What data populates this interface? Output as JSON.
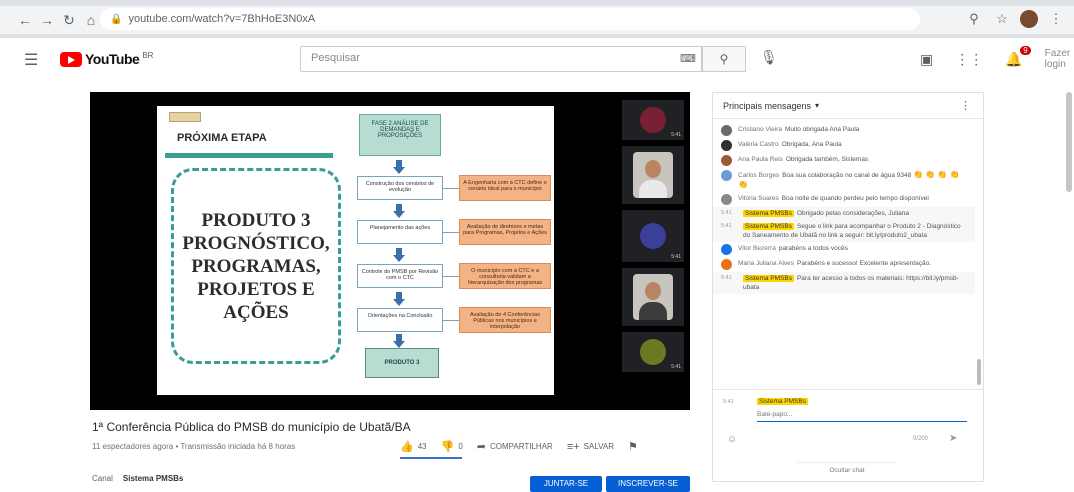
{
  "browser": {
    "url": "youtube.com/watch?v=7BhHoE3N0xA",
    "back_glyph": "←",
    "forward_glyph": "→",
    "reload_glyph": "↻",
    "home_glyph": "⌂"
  },
  "header": {
    "logo_text": "YouTube",
    "country_code": "BR",
    "search_placeholder": "Pesquisar",
    "signin_label": "Fazer login"
  },
  "slide": {
    "next_step": "PRÓXIMA ETAPA",
    "product_lines": [
      "PRODUTO 3",
      "PROGNÓSTICO,",
      "PROGRAMAS,",
      "PROJETOS E",
      "AÇÕES"
    ],
    "top_box": "FASE 2 ANÁLISE DE DEMANDAS E PROPOSIÇÕES",
    "steps": [
      "Construção dos cenários de evolução",
      "Planejamento das ações",
      "Controle do PMSB por Revisão com o CTC",
      "Orientações na Conclusão"
    ],
    "notes": [
      "A Engenharia com a CTC define o cenário ideal para o município",
      "Avaliação de diretrizes e metas para Programas, Projetos e Ações",
      "O município com a CTC e a consultoria validam a hierarquização dos programas",
      "Avaliação de 4 Conferências Públicas nos municípios e interpolação"
    ],
    "final_doc": "PRODUTO 3"
  },
  "participants": [
    {
      "time": "5:41",
      "color": "#7a2033"
    },
    {
      "time": "5:41",
      "color": "#3a3f9a"
    },
    {
      "time": "5:41",
      "color": "#6b7a20"
    }
  ],
  "video": {
    "title": "1ª Conferência Pública do PMSB do município de Ubatã/BA",
    "meta": "11 espectadores agora • Transmissão iniciada há 8 horas",
    "like_count": "43",
    "dislike_count": "0",
    "share_label": "COMPARTILHAR",
    "save_label": "SALVAR",
    "channel_prefix": "Canal",
    "channel_name": "Sistema PMSBs",
    "join_label": "JUNTAR-SE",
    "subscribe_label": "INSCREVER-SE"
  },
  "chat": {
    "header_title": "Principais mensagens",
    "messages": [
      {
        "author": "Cristiano Vieira",
        "text": "Muito obrigada Ana Paula",
        "time": "",
        "avatar": "#6a6a6a",
        "hl": false
      },
      {
        "author": "Valéria Castro",
        "text": "Obrigada, Ana Paula",
        "time": "",
        "avatar": "#303030",
        "hl": false
      },
      {
        "author": "Ana Paula Reis",
        "text": "Obrigada também, Sistemas",
        "time": "",
        "avatar": "#9a5a3a",
        "hl": false
      },
      {
        "author": "Carlos Borges",
        "text": "Boa sua colaboração no canal de água 9348",
        "time": "",
        "avatar": "#6a9ad8",
        "hl": false,
        "emoji": "👏 👏 👏 👏 👏"
      },
      {
        "author": "Vitória Soares",
        "text": "Boa noite de quando perdeu pelo tempo disponível",
        "time": "",
        "avatar": "#888888",
        "hl": false
      },
      {
        "author": "Sistema PMSBs",
        "text": "Obrigado pelas considerações, Juliana",
        "time": "5:41",
        "avatar": "",
        "hl": true
      },
      {
        "author": "Sistema PMSBs",
        "text": "Segue o link para acompanhar o Produto 2 - Diagnóstico do Saneamento de Ubatã no link a seguir: bit.ly/produto2_ubata",
        "time": "5:41",
        "avatar": "",
        "hl": true
      },
      {
        "author": "Vitor Bezerra",
        "text": "parabéns a todos vocês",
        "time": "",
        "avatar": "#1a73e8",
        "hl": false
      },
      {
        "author": "Maria Juliana Alves",
        "text": "Parabéns e sucesso! Excelente apresentação.",
        "time": "",
        "avatar": "#e8711a",
        "hl": false
      },
      {
        "author": "Sistema PMSBs",
        "text": "Para ter acesso a todos os materiais: https://bit.ly/pmsb-ubata",
        "time": "5:41",
        "avatar": "",
        "hl": true
      }
    ],
    "input_author": "Sistema PMSBs",
    "input_time": "5:41",
    "input_placeholder": "Bate-papo...",
    "char_count": "0/200",
    "hide_label": "Ocultar chat"
  }
}
